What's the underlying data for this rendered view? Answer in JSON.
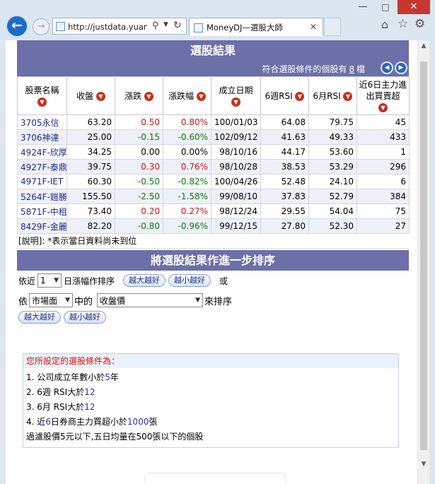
{
  "browser": {
    "address": "http://justdata.yuant...",
    "tab_title": "MoneyDJ—選股大師",
    "minimize": "—",
    "maximize": "□",
    "close": "✕"
  },
  "results": {
    "heading": "選股結果",
    "count_prefix": "符合選股條件的個股有",
    "count_value": "8",
    "count_suffix": "檔",
    "columns": [
      "股票名稱",
      "收盤",
      "漲跌",
      "漲跌幅",
      "成立日期",
      "6週RSI",
      "6月RSI",
      "近6日主力進出買賣超"
    ],
    "rows": [
      {
        "stock": "3705永信",
        "close": "63.20",
        "change": "0.50",
        "change_pct": "0.80%",
        "date": "100/01/03",
        "rsi6w": "64.08",
        "rsi6m": "79.75",
        "net": "45",
        "dir": "pos"
      },
      {
        "stock": "3706神達",
        "close": "25.00",
        "change": "-0.15",
        "change_pct": "-0.60%",
        "date": "102/09/12",
        "rsi6w": "41.63",
        "rsi6m": "49.33",
        "net": "433",
        "dir": "neg"
      },
      {
        "stock": "4924F-欣厚",
        "close": "34.25",
        "change": "0.00",
        "change_pct": "0.00%",
        "date": "98/10/16",
        "rsi6w": "44.17",
        "rsi6m": "53.60",
        "net": "1",
        "dir": "flat"
      },
      {
        "stock": "4927F-泰鼎",
        "close": "39.75",
        "change": "0.30",
        "change_pct": "0.76%",
        "date": "98/10/28",
        "rsi6w": "38.53",
        "rsi6m": "53.29",
        "net": "296",
        "dir": "pos"
      },
      {
        "stock": "4971F-IET",
        "close": "60.30",
        "change": "-0.50",
        "change_pct": "-0.82%",
        "date": "100/04/26",
        "rsi6w": "52.48",
        "rsi6m": "24.10",
        "net": "6",
        "dir": "neg"
      },
      {
        "stock": "5264F-鎧勝",
        "close": "155.50",
        "change": "-2.50",
        "change_pct": "-1.58%",
        "date": "99/08/10",
        "rsi6w": "37.83",
        "rsi6m": "52.79",
        "net": "384",
        "dir": "neg"
      },
      {
        "stock": "5871F-中租",
        "close": "73.40",
        "change": "0.20",
        "change_pct": "0.27%",
        "date": "98/12/24",
        "rsi6w": "29.55",
        "rsi6m": "54.04",
        "net": "75",
        "dir": "pos"
      },
      {
        "stock": "8429F-金麗",
        "close": "82.20",
        "change": "-0.80",
        "change_pct": "-0.96%",
        "date": "99/12/15",
        "rsi6w": "27.80",
        "rsi6m": "52.30",
        "net": "27",
        "dir": "neg"
      }
    ],
    "note": "[說明]: *表示當日資料尚未到位"
  },
  "sorting": {
    "heading": "將選股結果作進一步排序",
    "line1_prefix": "依近",
    "days_value": "1",
    "line1_suffix": "日漲幅作排序",
    "bigger_label": "越大越好",
    "smaller_label": "越小越好",
    "or_label": "或",
    "line2_prefix": "依",
    "market_value": "市場面",
    "line2_mid": "中的",
    "field_value": "收盤價",
    "line2_suffix": "來排序"
  },
  "criteria": {
    "title": "您所設定的選股條件為：",
    "items": [
      {
        "prefix": "1. 公司成立年數小於",
        "value": "5",
        "suffix": "年"
      },
      {
        "prefix": "2. 6週 RSI大於",
        "value": "12",
        "suffix": ""
      },
      {
        "prefix": "3. 6月 RSI大於",
        "value": "12",
        "suffix": ""
      },
      {
        "prefix": "4. 近",
        "value": "6",
        "mid": "日券商主力買超小於",
        "value2": "1000",
        "suffix": "張"
      }
    ],
    "extra": "過濾股價5元以下,五日均量在500張以下的個股"
  },
  "colors": {
    "header_band": "#6c6fa8",
    "up": "#e01010",
    "down": "#0a7a0a",
    "link": "#1d2a8a"
  }
}
